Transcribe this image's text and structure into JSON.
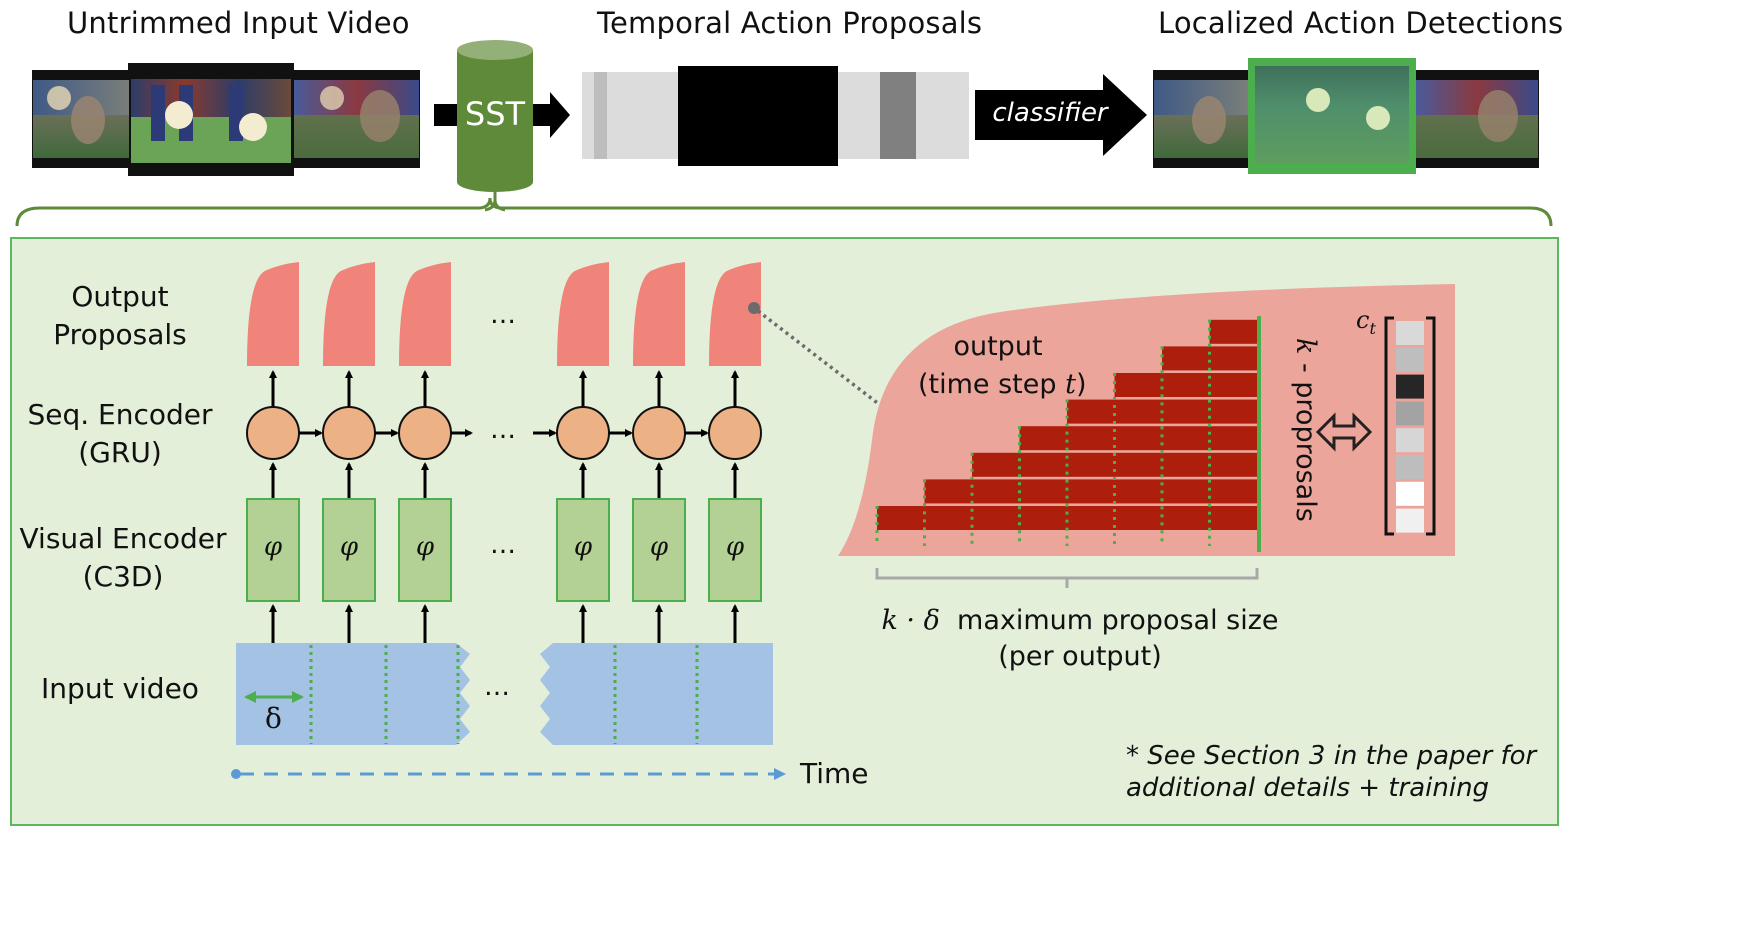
{
  "top_row": {
    "input_title": "Untrimmed  Input Video",
    "proposals_title": "Temporal Action Proposals",
    "detections_title": "Localized Action Detections",
    "model_label": "SST",
    "classifier_label": "classifier",
    "proposal_bar_segments": [
      {
        "name": "background",
        "shade": "#dcdcdc"
      },
      {
        "name": "weak-proposal",
        "shade": "#bdbdbd"
      },
      {
        "name": "strong-proposal",
        "shade": "#000000"
      },
      {
        "name": "medium-proposal",
        "shade": "#808080"
      }
    ]
  },
  "panel": {
    "row_labels": {
      "output": [
        "Output",
        "Proposals"
      ],
      "seq_encoder": [
        "Seq. Encoder",
        "(GRU)"
      ],
      "visual_encoder": [
        "Visual Encoder",
        "(C3D)"
      ],
      "input_video": [
        "Input video"
      ]
    },
    "phi_symbol": "φ",
    "ellipsis": "…",
    "delta_symbol": "δ",
    "time_label": "Time",
    "num_timesteps_shown": 6,
    "detail": {
      "output_line1": "output",
      "output_line2_prefix": "(time step ",
      "output_line2_var": "t",
      "output_line2_suffix": ")",
      "k_proposals_var": "k",
      "k_proposals_text": " - proprosals",
      "ct_label_base": "c",
      "ct_label_sub": "t",
      "num_proposals": 8,
      "confidence_shades": [
        "#d9d9d9",
        "#bebebe",
        "#262626",
        "#a3a3a3",
        "#d6d6d6",
        "#bdbdbd",
        "#ffffff",
        "#f0f0f0"
      ],
      "max_size_var": "k · δ",
      "max_size_text": "maximum  proposal size",
      "max_size_line2": "(per output)"
    },
    "footnote_line1": "* See Section 3 in the paper for",
    "footnote_line2": "additional details + training"
  },
  "colors": {
    "sst_green": "#5f8a3a",
    "panel_bg": "#e3efd9",
    "panel_border": "#5cb85c",
    "output_pink": "#f0837a",
    "gru_orange": "#ecb185",
    "c3d_green": "#b3d194",
    "c3d_border": "#4cae4c",
    "video_blue": "#a4c2e4",
    "proposal_red": "#ad1e0c",
    "detail_pink": "#eca59a",
    "detect_green": "#4cae4c"
  }
}
